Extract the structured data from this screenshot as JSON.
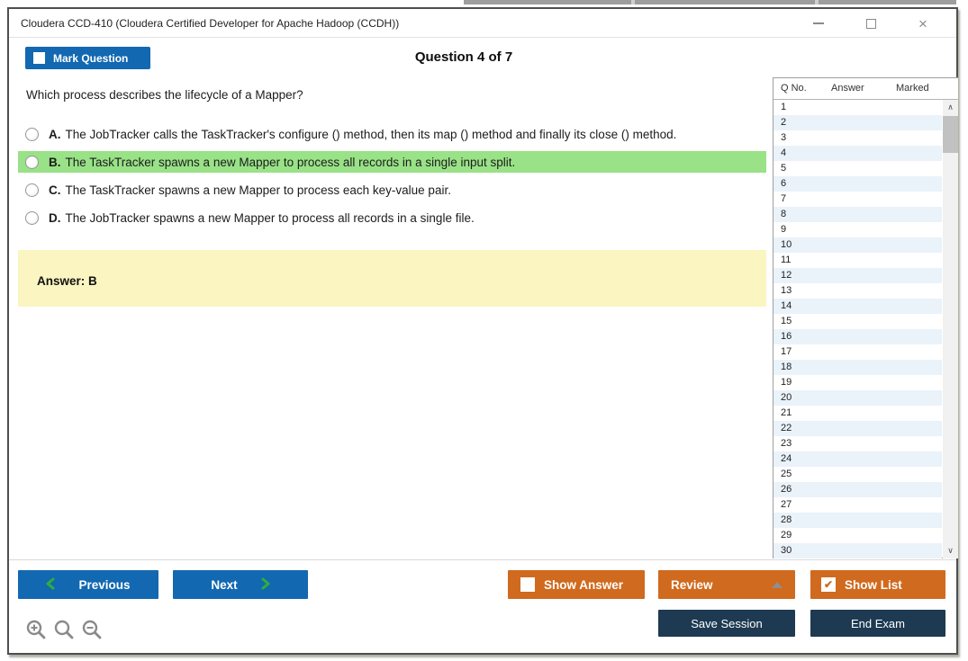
{
  "window": {
    "title": "Cloudera CCD-410 (Cloudera Certified Developer for Apache Hadoop (CCDH))"
  },
  "header": {
    "mark_question": "Mark Question",
    "question_counter": "Question 4 of 7"
  },
  "question": {
    "text": "Which process describes the lifecycle of a Mapper?",
    "options": [
      {
        "letter": "A.",
        "text": "The JobTracker calls the TaskTracker's configure () method, then its map () method and finally its close () method.",
        "highlighted": false
      },
      {
        "letter": "B.",
        "text": "The TaskTracker spawns a new Mapper to process all records in a single input split.",
        "highlighted": true
      },
      {
        "letter": "C.",
        "text": "The TaskTracker spawns a new Mapper to process each key-value pair.",
        "highlighted": false
      },
      {
        "letter": "D.",
        "text": "The JobTracker spawns a new Mapper to process all records in a single file.",
        "highlighted": false
      }
    ],
    "answer": "Answer: B"
  },
  "panel": {
    "columns": {
      "q_no": "Q No.",
      "answer": "Answer",
      "marked": "Marked"
    },
    "rows": [
      "1",
      "2",
      "3",
      "4",
      "5",
      "6",
      "7",
      "8",
      "9",
      "10",
      "11",
      "12",
      "13",
      "14",
      "15",
      "16",
      "17",
      "18",
      "19",
      "20",
      "21",
      "22",
      "23",
      "24",
      "25",
      "26",
      "27",
      "28",
      "29",
      "30"
    ]
  },
  "footer": {
    "previous": "Previous",
    "next": "Next",
    "show_answer": "Show Answer",
    "review": "Review",
    "show_list": "Show List",
    "save_session": "Save Session",
    "end_exam": "End Exam"
  },
  "icons": {
    "close": "×",
    "scroll_up": "∧",
    "scroll_down": "∨",
    "check": "✔"
  },
  "colors": {
    "button_blue": "#1268b1",
    "button_orange": "#d06a1e",
    "button_navy": "#1d3a52",
    "highlight_green": "#99e287",
    "answer_yellow": "#faf5c1",
    "row_alt_blue": "#eaf2fa",
    "chevron_green": "#2fae3c"
  }
}
